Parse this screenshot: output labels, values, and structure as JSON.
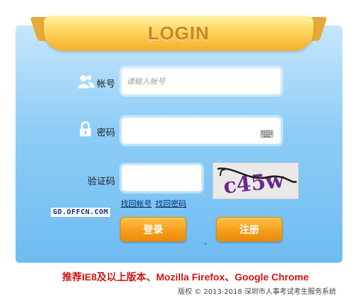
{
  "header": {
    "title": "LOGIN"
  },
  "account": {
    "label": "帐号",
    "placeholder": "请输入帐号",
    "value": ""
  },
  "password": {
    "label": "密码",
    "value": ""
  },
  "captcha": {
    "label": "验证码",
    "value": "",
    "image_text": "c45w"
  },
  "links": {
    "find_account": "找回帐号",
    "find_password": "找回密码"
  },
  "watermark": "GD.OFFCN.COM",
  "buttons": {
    "login": "登录",
    "register": "注册"
  },
  "footer": {
    "browser_notice": "推荐IE8及以上版本、Mozilla Firefox、Google Chrome",
    "copyright": "版权 © 2013-2018 深圳市人事考试考生服务系统"
  },
  "colors": {
    "panel_top": "#c7e6fb",
    "panel_bottom": "#6fbcf1",
    "button_orange": "#f59b17",
    "notice_red": "#d21414",
    "title_gold": "#c5892a"
  },
  "icons": {
    "account": "users-icon",
    "password": "lock-icon",
    "keyboard": "keyboard-icon"
  }
}
